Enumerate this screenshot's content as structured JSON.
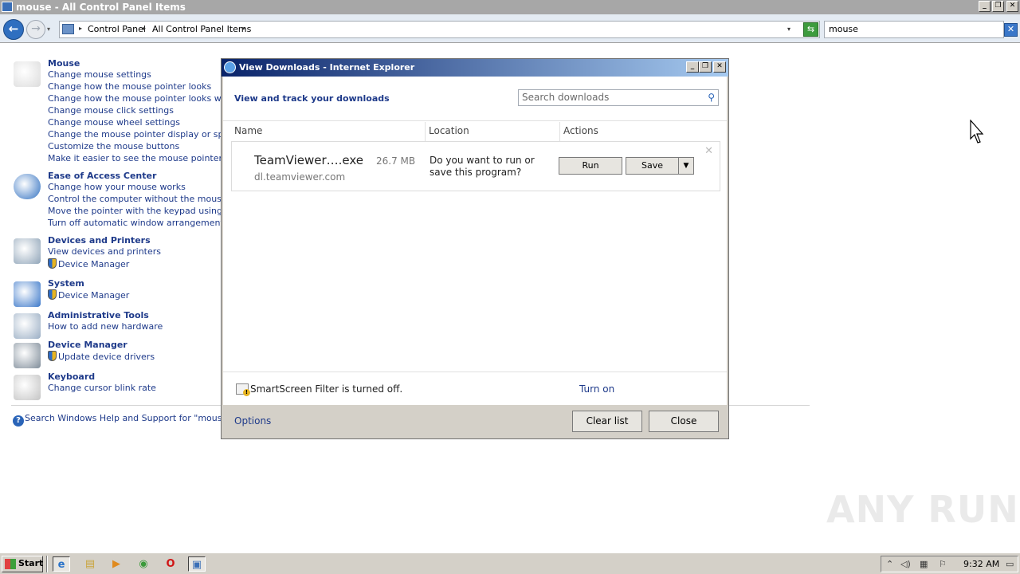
{
  "window": {
    "title": "mouse - All Control Panel Items",
    "controls": {
      "minimize": "_",
      "restore": "❐",
      "close": "✕"
    }
  },
  "addressbar": {
    "breadcrumbs": [
      "Control Panel",
      "All Control Panel Items"
    ],
    "search_value": "mouse",
    "back_glyph": "←",
    "fwd_glyph": "→",
    "dropdown_glyph": "▾",
    "crumb_sep_glyph": "▸",
    "refresh_glyph": "⇆",
    "clear_glyph": "✕"
  },
  "sections": [
    {
      "title": "Mouse",
      "icon": "mouse-icon",
      "links": [
        {
          "text": "Change mouse settings"
        },
        {
          "text": "Change how the mouse pointer looks"
        },
        {
          "text": "Change how the mouse pointer looks when it"
        },
        {
          "text": "Change mouse click settings"
        },
        {
          "text": "Change mouse wheel settings"
        },
        {
          "text": "Change the mouse pointer display or speed"
        },
        {
          "text": "Customize the mouse buttons"
        },
        {
          "text": "Make it easier to see the mouse pointer"
        }
      ]
    },
    {
      "title": "Ease of Access Center",
      "icon": "ease-of-access-icon",
      "links": [
        {
          "text": "Change how your mouse works"
        },
        {
          "text": "Control the computer without the mouse or k"
        },
        {
          "text": "Move the pointer with the keypad using Mous"
        },
        {
          "text": "Turn off automatic window arrangement"
        }
      ]
    },
    {
      "title": "Devices and Printers",
      "icon": "devices-printers-icon",
      "links": [
        {
          "text": "View devices and printers"
        },
        {
          "text": "Device Manager",
          "shield": true
        }
      ]
    },
    {
      "title": "System",
      "icon": "system-icon",
      "links": [
        {
          "text": "Device Manager",
          "shield": true
        }
      ]
    },
    {
      "title": "Administrative Tools",
      "icon": "administrative-tools-icon",
      "links": [
        {
          "text": "How to add new hardware"
        }
      ]
    },
    {
      "title": "Device Manager",
      "icon": "device-manager-icon",
      "links": [
        {
          "text": "Update device drivers",
          "shield": true
        }
      ]
    },
    {
      "title": "Keyboard",
      "icon": "keyboard-icon",
      "links": [
        {
          "text": "Change cursor blink rate"
        }
      ]
    }
  ],
  "help_link": "Search Windows Help and Support for \"mouse\"",
  "help_glyph": "?",
  "dialog": {
    "title": "View Downloads - Internet Explorer",
    "heading": "View and track your downloads",
    "search_placeholder": "Search downloads",
    "search_glyph": "⚲",
    "columns": [
      "Name",
      "Location",
      "Actions"
    ],
    "download": {
      "filename": "TeamViewer….exe",
      "size": "26.7 MB",
      "host": "dl.teamviewer.com",
      "question": "Do you want to run or save this program?",
      "run_label": "Run",
      "save_label": "Save",
      "split_glyph": "▼",
      "dismiss_glyph": "✕"
    },
    "smartscreen_text": "SmartScreen Filter is turned off.",
    "smartscreen_action": "Turn on",
    "warning_glyph": "!",
    "options_label": "Options",
    "clear_list_label": "Clear list",
    "close_label": "Close"
  },
  "taskbar": {
    "start_label": "Start",
    "clock": "9:32 AM",
    "pinned": [
      {
        "name": "internet-explorer-icon",
        "glyph": "e",
        "color": "#2a73c9",
        "active": true
      },
      {
        "name": "file-explorer-icon",
        "glyph": "▤",
        "color": "#c9a33a",
        "active": false
      },
      {
        "name": "media-player-icon",
        "glyph": "▶",
        "color": "#e08a1e",
        "active": false
      },
      {
        "name": "chrome-icon",
        "glyph": "◉",
        "color": "#3a9a3a",
        "active": false
      },
      {
        "name": "opera-icon",
        "glyph": "O",
        "color": "#d01515",
        "active": false
      },
      {
        "name": "control-panel-taskbar-icon",
        "glyph": "▣",
        "color": "#3a6fb7",
        "active": true
      }
    ],
    "tray_glyphs": {
      "expand": "⌃",
      "volume": "◁)",
      "network": "▦",
      "flag": "⚐",
      "desktop": "▭"
    }
  },
  "watermark": "ANY RUN"
}
